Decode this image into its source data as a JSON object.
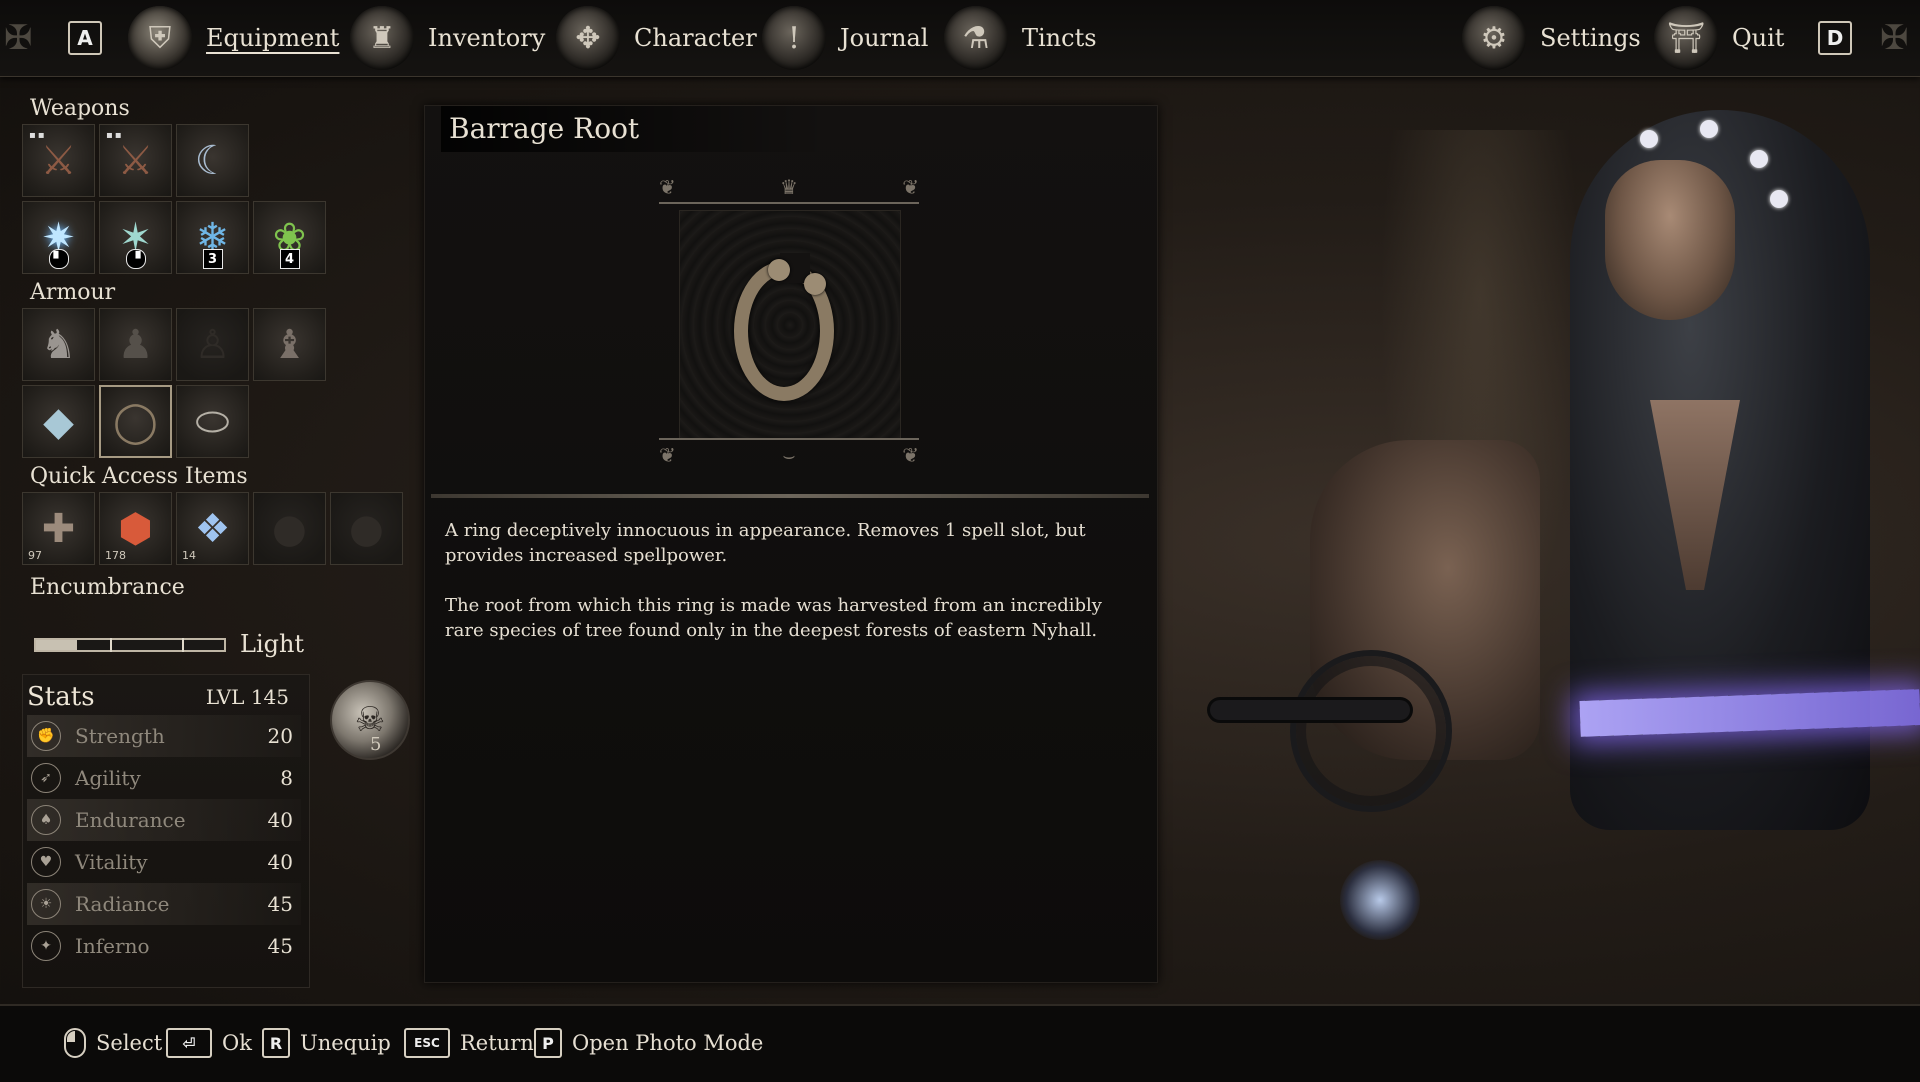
{
  "topnav": {
    "left_key": "A",
    "right_key": "D",
    "tabs": [
      {
        "label": "Equipment",
        "icon": "helmet-icon"
      },
      {
        "label": "Inventory",
        "icon": "pouch-icon"
      },
      {
        "label": "Character",
        "icon": "crest-icon"
      },
      {
        "label": "Journal",
        "icon": "quill-icon"
      },
      {
        "label": "Tincts",
        "icon": "flask-icon"
      }
    ],
    "settings_label": "Settings",
    "quit_label": "Quit"
  },
  "equipment": {
    "weapons_title": "Weapons",
    "weapons_row1": [
      {
        "icon": "crossbow-icon",
        "glyph": "⚔"
      },
      {
        "icon": "crossbow-icon",
        "glyph": "⚔"
      },
      {
        "icon": "claw-icon",
        "glyph": "☾"
      }
    ],
    "weapons_row2": [
      {
        "icon": "spell-burst-icon",
        "glyph": "✷",
        "badge": ""
      },
      {
        "icon": "spell-thorn-icon",
        "glyph": "✶",
        "badge": ""
      },
      {
        "icon": "spell-shards-icon",
        "glyph": "❄",
        "badge": "3"
      },
      {
        "icon": "spell-vine-icon",
        "glyph": "❀",
        "badge": "4"
      }
    ],
    "armour_title": "Armour",
    "quick_title": "Quick Access Items",
    "quick_counts": [
      "97",
      "178",
      "14"
    ],
    "encumbrance_title": "Encumbrance",
    "encumbrance_label": "Light",
    "encumbrance_level": 0.22
  },
  "stats": {
    "title": "Stats",
    "level": "LVL 145",
    "rows": [
      {
        "name": "Strength",
        "value": "20",
        "icon": "strength-icon",
        "glyph": "✊"
      },
      {
        "name": "Agility",
        "value": "8",
        "icon": "agility-icon",
        "glyph": "➶"
      },
      {
        "name": "Endurance",
        "value": "40",
        "icon": "endurance-icon",
        "glyph": "♠"
      },
      {
        "name": "Vitality",
        "value": "40",
        "icon": "vitality-icon",
        "glyph": "♥"
      },
      {
        "name": "Radiance",
        "value": "45",
        "icon": "radiance-icon",
        "glyph": "☀"
      },
      {
        "name": "Inferno",
        "value": "45",
        "icon": "inferno-icon",
        "glyph": "✦"
      }
    ],
    "skull_count": "5"
  },
  "item": {
    "name": "Barrage Root",
    "description": [
      "A ring deceptively innocuous in appearance. Removes 1 spell slot, but provides increased spellpower.",
      "The root from which this ring is made was harvested from an incredibly rare species of tree found only in the deepest forests of eastern Nyhall."
    ]
  },
  "hints": [
    {
      "key": "",
      "type": "mouse",
      "label": "Select"
    },
    {
      "key": "⏎",
      "type": "key",
      "label": "Ok"
    },
    {
      "key": "R",
      "type": "key",
      "label": "Unequip"
    },
    {
      "key": "ESC",
      "type": "key",
      "label": "Return"
    },
    {
      "key": "P",
      "type": "key",
      "label": "Open Photo Mode"
    }
  ],
  "colors": {
    "background": "#221c17",
    "panel": "#131110",
    "text": "#e6dfd2",
    "muted_text": "#8f887c",
    "sword_glow": "#8c6eff"
  }
}
